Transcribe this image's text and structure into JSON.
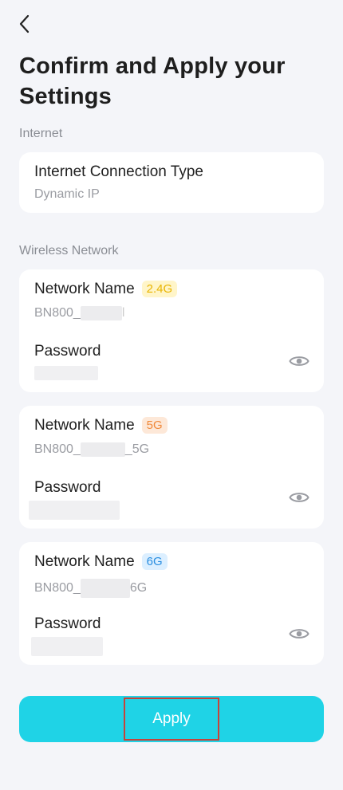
{
  "header": {
    "back_icon": "chevron-left-icon",
    "title": "Confirm and Apply your Settings"
  },
  "internet": {
    "section_label": "Internet",
    "connection_type_label": "Internet Connection Type",
    "connection_type_value": "Dynamic IP"
  },
  "wireless": {
    "section_label": "Wireless Network",
    "networks": [
      {
        "name_label": "Network Name",
        "band": "2.4G",
        "ssid": "BN800_",
        "password_label": "Password"
      },
      {
        "name_label": "Network Name",
        "band": "5G",
        "ssid": "BN800_",
        "ssid_suffix": "_5G",
        "password_label": "Password"
      },
      {
        "name_label": "Network Name",
        "band": "6G",
        "ssid": "BN800_",
        "ssid_suffix": "6G",
        "password_label": "Password"
      }
    ]
  },
  "actions": {
    "apply_label": "Apply"
  },
  "colors": {
    "accent": "#1fd3e6",
    "badge_24": "#e8b400",
    "badge_5": "#f08a3c",
    "badge_6": "#2a8ee0"
  }
}
